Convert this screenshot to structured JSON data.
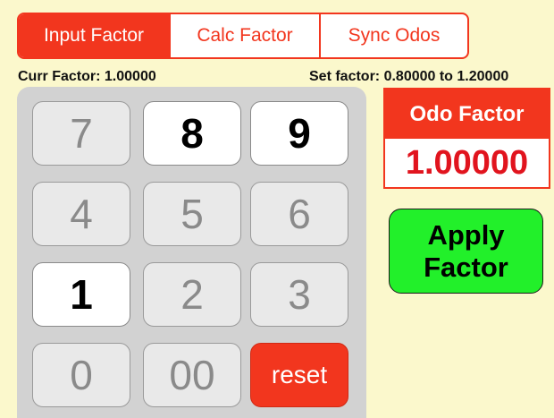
{
  "tabs": [
    {
      "label": "Input Factor",
      "active": true
    },
    {
      "label": "Calc Factor",
      "active": false
    },
    {
      "label": "Sync Odos",
      "active": false
    }
  ],
  "status": {
    "current_factor": "Curr Factor: 1.00000",
    "set_range": "Set factor: 0.80000 to 1.20000"
  },
  "keypad": {
    "k7": "7",
    "k8": "8",
    "k9": "9",
    "k4": "4",
    "k5": "5",
    "k6": "6",
    "k1": "1",
    "k2": "2",
    "k3": "3",
    "k0": "0",
    "k00": "00",
    "reset": "reset"
  },
  "odo": {
    "title": "Odo Factor",
    "value": "1.00000"
  },
  "apply": {
    "line1": "Apply",
    "line2": "Factor"
  },
  "colors": {
    "background": "#fbf8cc",
    "accent_red": "#f2361e",
    "value_red": "#e1141e",
    "apply_green": "#22f02a",
    "keypad_bg": "#d2d2d2"
  }
}
